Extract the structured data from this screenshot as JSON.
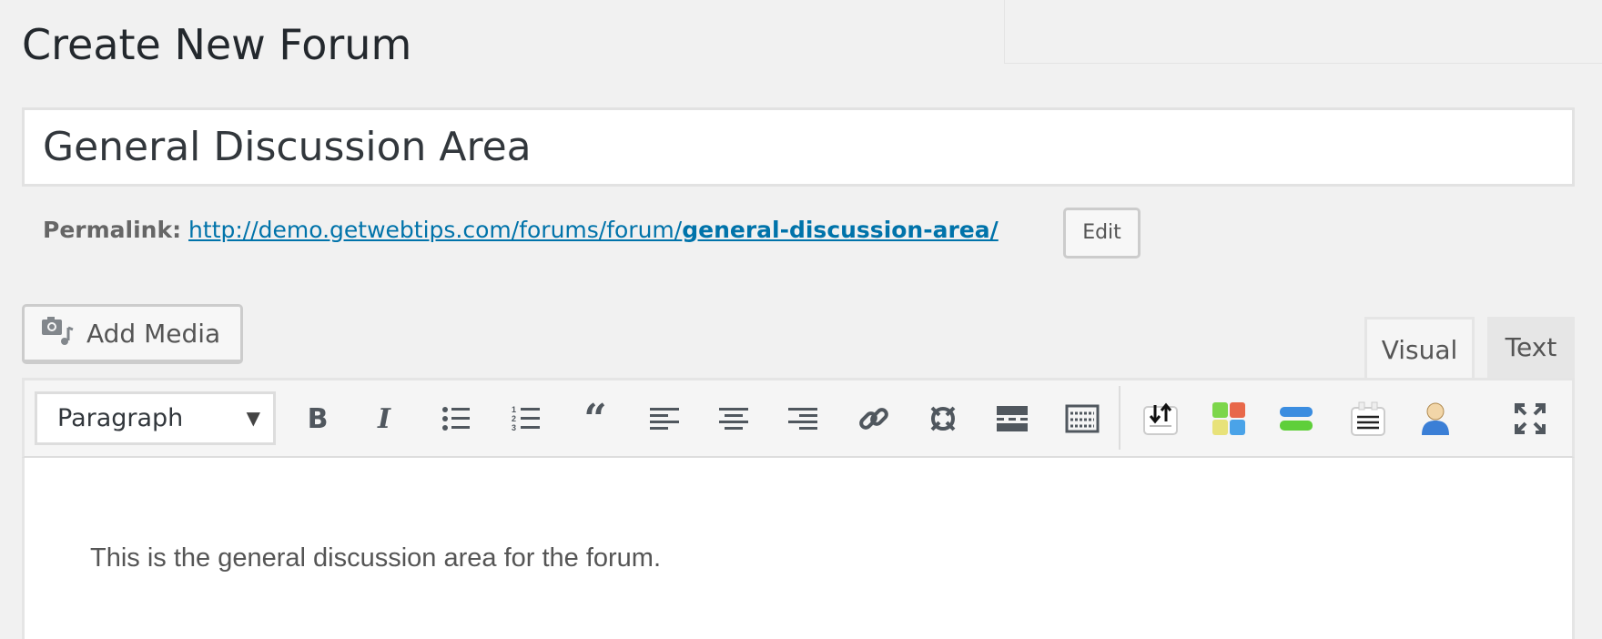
{
  "page_title": "Create New Forum",
  "title_field": {
    "value": "General Discussion Area"
  },
  "permalink": {
    "label": "Permalink:",
    "url_base": "http://demo.getwebtips.com/forums/forum/",
    "slug": "general-discussion-area/",
    "edit_label": "Edit"
  },
  "add_media_label": "Add Media",
  "tabs": [
    {
      "label": "Visual",
      "active": true
    },
    {
      "label": "Text",
      "active": false
    }
  ],
  "toolbar": {
    "format_select": "Paragraph",
    "buttons": [
      "bold",
      "italic",
      "bulleted-list",
      "numbered-list",
      "blockquote",
      "align-left",
      "align-center",
      "align-right",
      "insert-link",
      "remove-link",
      "read-more",
      "toolbar-toggle",
      "upload",
      "color-grid",
      "toggle-bars",
      "clipboard",
      "user",
      "fullscreen"
    ]
  },
  "editor": {
    "content": "This is the general discussion area for the forum."
  },
  "colors": {
    "link": "#0073aa",
    "background": "#f1f1f1"
  }
}
